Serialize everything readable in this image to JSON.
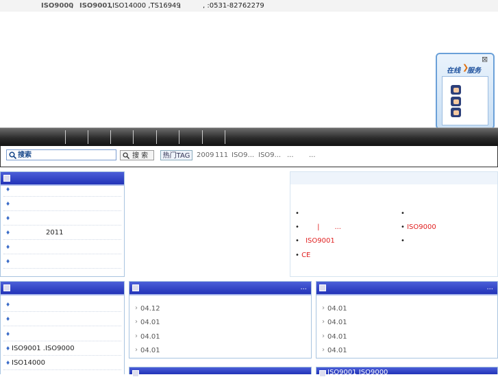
{
  "topbar": {
    "item1": "ISO9000",
    "sep1": ",",
    "item2": "ISO9001",
    "item3": ",ISO14000 ,TS16949",
    "sep2": ",",
    "phone": ", :0531-82762279"
  },
  "online_service": {
    "title_a": "在线",
    "title_b": "服务",
    "close": "⊠"
  },
  "search": {
    "placeholder": "搜索",
    "button": "搜 索",
    "hot_tag": "热门TAG",
    "tags": [
      "2009",
      "111",
      "ISO9...",
      "ISO9...",
      "...",
      "..."
    ]
  },
  "left_panel_1": {
    "rows": [
      "",
      "",
      "",
      "2011",
      "",
      ""
    ]
  },
  "right_info": {
    "col1": [
      "",
      "|",
      "...",
      "ISO9001",
      "CE"
    ],
    "col2": [
      "",
      "ISO9000",
      ""
    ]
  },
  "left_panel_2": {
    "rows": [
      "",
      "",
      "",
      "ISO9001 .ISO9000",
      "ISO14000"
    ]
  },
  "news_panel_1": {
    "more": "...",
    "dates": [
      "04.12",
      "04.01",
      "04.01",
      "04.01"
    ]
  },
  "news_panel_2": {
    "more": "...",
    "dates": [
      "04.01",
      "04.01",
      "04.01",
      "04.01"
    ]
  },
  "bottom_panel_2": {
    "title": "ISO9001 ISO9000"
  }
}
